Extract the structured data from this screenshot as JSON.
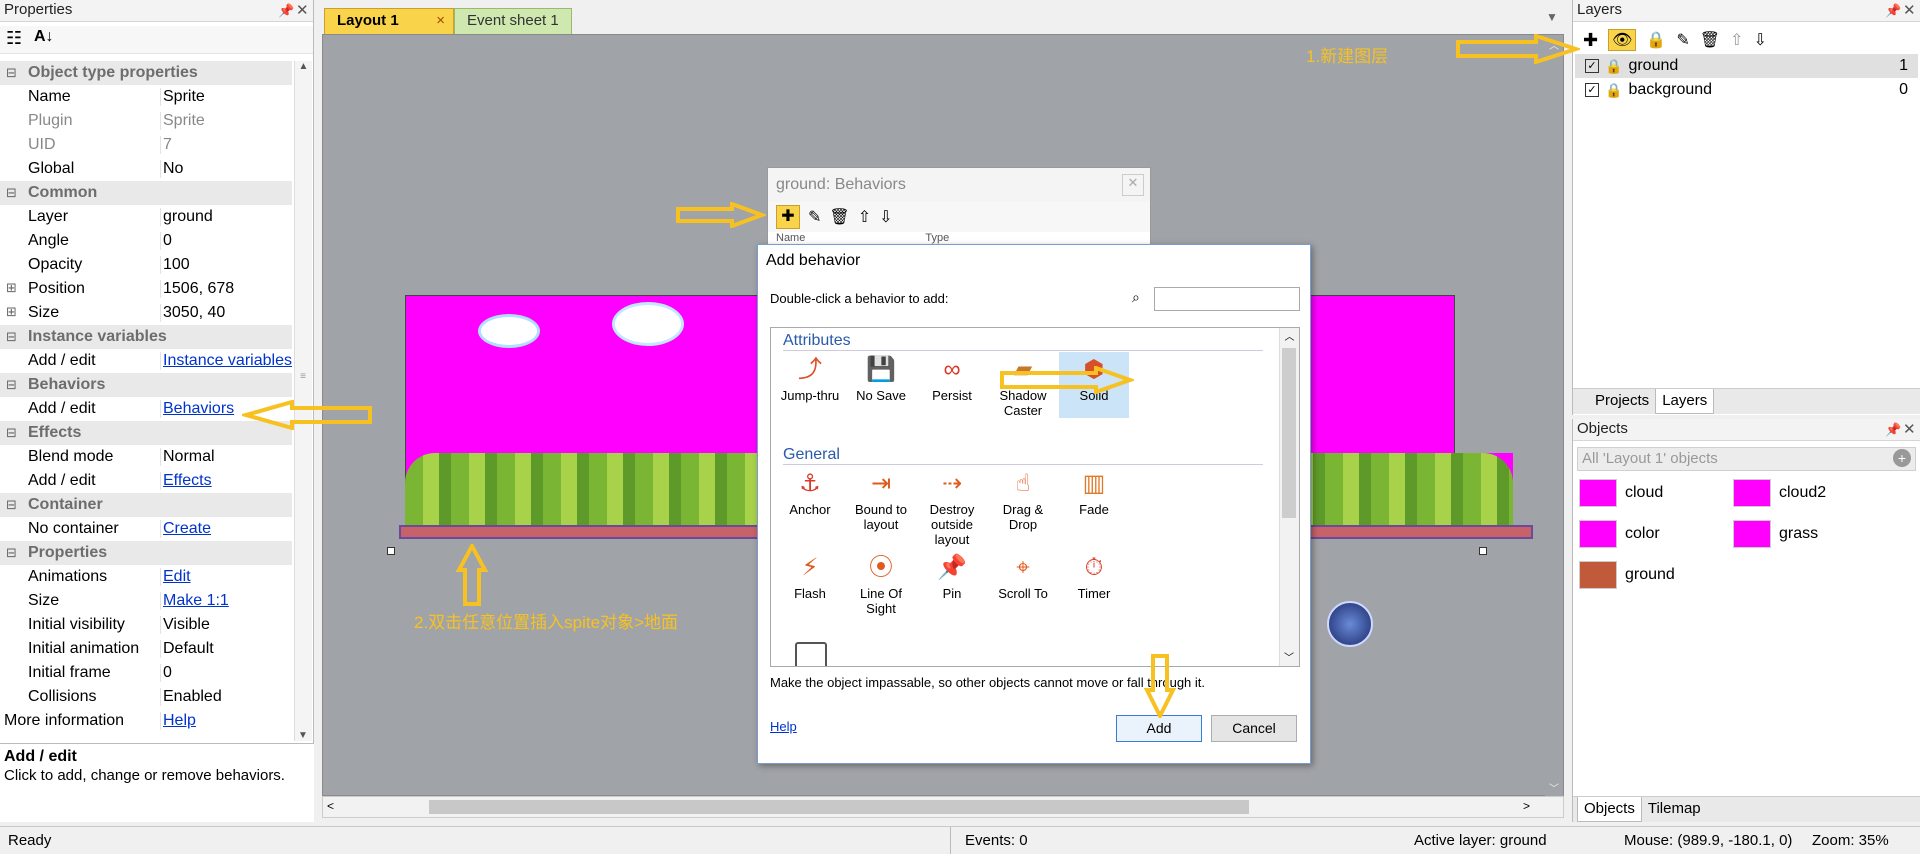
{
  "properties": {
    "title": "Properties",
    "rows": [
      {
        "type": "cat",
        "label": "Object type properties"
      },
      {
        "type": "row",
        "key": "Name",
        "value": "Sprite"
      },
      {
        "type": "row",
        "key": "Plugin",
        "value": "Sprite",
        "dim": true
      },
      {
        "type": "row",
        "key": "UID",
        "value": "7",
        "dim": true
      },
      {
        "type": "row",
        "key": "Global",
        "value": "No"
      },
      {
        "type": "cat",
        "label": "Common"
      },
      {
        "type": "row",
        "key": "Layer",
        "value": "ground"
      },
      {
        "type": "row",
        "key": "Angle",
        "value": "0"
      },
      {
        "type": "row",
        "key": "Opacity",
        "value": "100"
      },
      {
        "type": "row",
        "key": "Position",
        "value": "1506, 678",
        "expand": true
      },
      {
        "type": "row",
        "key": "Size",
        "value": "3050, 40",
        "expand": true
      },
      {
        "type": "cat",
        "label": "Instance variables"
      },
      {
        "type": "row",
        "key": "Add / edit",
        "value": "Instance variables",
        "link": true
      },
      {
        "type": "cat",
        "label": "Behaviors"
      },
      {
        "type": "row",
        "key": "Add / edit",
        "value": "Behaviors",
        "link": true
      },
      {
        "type": "cat",
        "label": "Effects"
      },
      {
        "type": "row",
        "key": "Blend mode",
        "value": "Normal"
      },
      {
        "type": "row",
        "key": "Add / edit",
        "value": "Effects",
        "link": true
      },
      {
        "type": "cat",
        "label": "Container"
      },
      {
        "type": "row",
        "key": "No container",
        "value": "Create",
        "link": true
      },
      {
        "type": "cat",
        "label": "Properties"
      },
      {
        "type": "row",
        "key": "Animations",
        "value": "Edit",
        "link": true
      },
      {
        "type": "row",
        "key": "Size",
        "value": "Make 1:1",
        "link": true
      },
      {
        "type": "row",
        "key": "Initial visibility",
        "value": "Visible"
      },
      {
        "type": "row",
        "key": "Initial animation",
        "value": "Default"
      },
      {
        "type": "row",
        "key": "Initial frame",
        "value": "0"
      },
      {
        "type": "row",
        "key": "Collisions",
        "value": "Enabled"
      },
      {
        "type": "more",
        "key": "More information",
        "value": "Help",
        "link": true
      }
    ],
    "desc_title": "Add / edit",
    "desc_text": "Click to add, change or remove behaviors."
  },
  "tabs": [
    {
      "label": "Layout 1",
      "active": true,
      "close": "×"
    },
    {
      "label": "Event sheet 1",
      "active": false
    }
  ],
  "behaviors_panel": {
    "title": "ground: Behaviors",
    "col_name": "Name",
    "col_type": "Type"
  },
  "dialog": {
    "title": "Add behavior",
    "prompt": "Double-click a behavior to add:",
    "search_placeholder": "",
    "groups": [
      {
        "name": "Attributes",
        "items": [
          {
            "label": "Jump-thru",
            "icon": "jump-thru-icon",
            "glyph": "⤴",
            "color": "#e0502a"
          },
          {
            "label": "No Save",
            "icon": "no-save-icon",
            "glyph": "💾",
            "color": "#555"
          },
          {
            "label": "Persist",
            "icon": "persist-icon",
            "glyph": "∞",
            "color": "#d83a2a"
          },
          {
            "label": "Shadow Caster",
            "icon": "shadow-caster-icon",
            "glyph": "▰",
            "color": "#c8762a"
          },
          {
            "label": "Solid",
            "icon": "solid-icon",
            "glyph": "⬢",
            "color": "#d8502a",
            "selected": true
          }
        ]
      },
      {
        "name": "General",
        "items": [
          {
            "label": "Anchor",
            "icon": "anchor-icon",
            "glyph": "⚓",
            "color": "#d83a2a"
          },
          {
            "label": "Bound to layout",
            "icon": "bound-to-layout-icon",
            "glyph": "⇥",
            "color": "#e05a1e"
          },
          {
            "label": "Destroy outside layout",
            "icon": "destroy-outside-layout-icon",
            "glyph": "⇢",
            "color": "#e05a1e"
          },
          {
            "label": "Drag & Drop",
            "icon": "drag-drop-icon",
            "glyph": "☝",
            "color": "#e05a1e"
          },
          {
            "label": "Fade",
            "icon": "fade-icon",
            "glyph": "▥",
            "color": "#e07a2a"
          },
          {
            "label": "Flash",
            "icon": "flash-icon",
            "glyph": "⚡",
            "color": "#e05a1e"
          },
          {
            "label": "Line Of Sight",
            "icon": "line-of-sight-icon",
            "glyph": "⦿",
            "color": "#e05a1e"
          },
          {
            "label": "Pin",
            "icon": "pin-icon",
            "glyph": "📌",
            "color": "#e05a1e"
          },
          {
            "label": "Scroll To",
            "icon": "scroll-to-icon",
            "glyph": "⌖",
            "color": "#e05a1e"
          },
          {
            "label": "Timer",
            "icon": "timer-icon",
            "glyph": "⏱",
            "color": "#d83a2a"
          }
        ]
      }
    ],
    "description": "Make the object impassable, so other objects cannot move or fall through it.",
    "help": "Help",
    "add": "Add",
    "cancel": "Cancel"
  },
  "layers": {
    "title": "Layers",
    "items": [
      {
        "name": "ground",
        "index": "1",
        "selected": true
      },
      {
        "name": "background",
        "index": "0",
        "selected": false
      }
    ],
    "tabs": [
      "Projects",
      "Layers"
    ]
  },
  "objects": {
    "title": "Objects",
    "filter": "All 'Layout 1' objects",
    "items": [
      {
        "name": "cloud",
        "thumb": "#ff00ff"
      },
      {
        "name": "cloud2",
        "thumb": "#ff00ff"
      },
      {
        "name": "color",
        "thumb": "#ff00ff"
      },
      {
        "name": "grass",
        "thumb": "#ff00ff"
      },
      {
        "name": "ground",
        "thumb": "#c05a3a"
      }
    ],
    "tabs": [
      "Objects",
      "Tilemap"
    ]
  },
  "annotations": {
    "new_layer": "1.新建图层",
    "insert_sprite": "2.双击任意位置插入spite对象>地面"
  },
  "status": {
    "ready": "Ready",
    "events": "Events: 0",
    "active_layer": "Active layer: ground",
    "mouse": "Mouse: (989.9, -180.1, 0)",
    "zoom": "Zoom: 35%"
  },
  "colors": {
    "accent": "#f7c221",
    "magenta": "#ff00ff",
    "link": "#0033cc",
    "canvas": "#a0a3a7"
  }
}
